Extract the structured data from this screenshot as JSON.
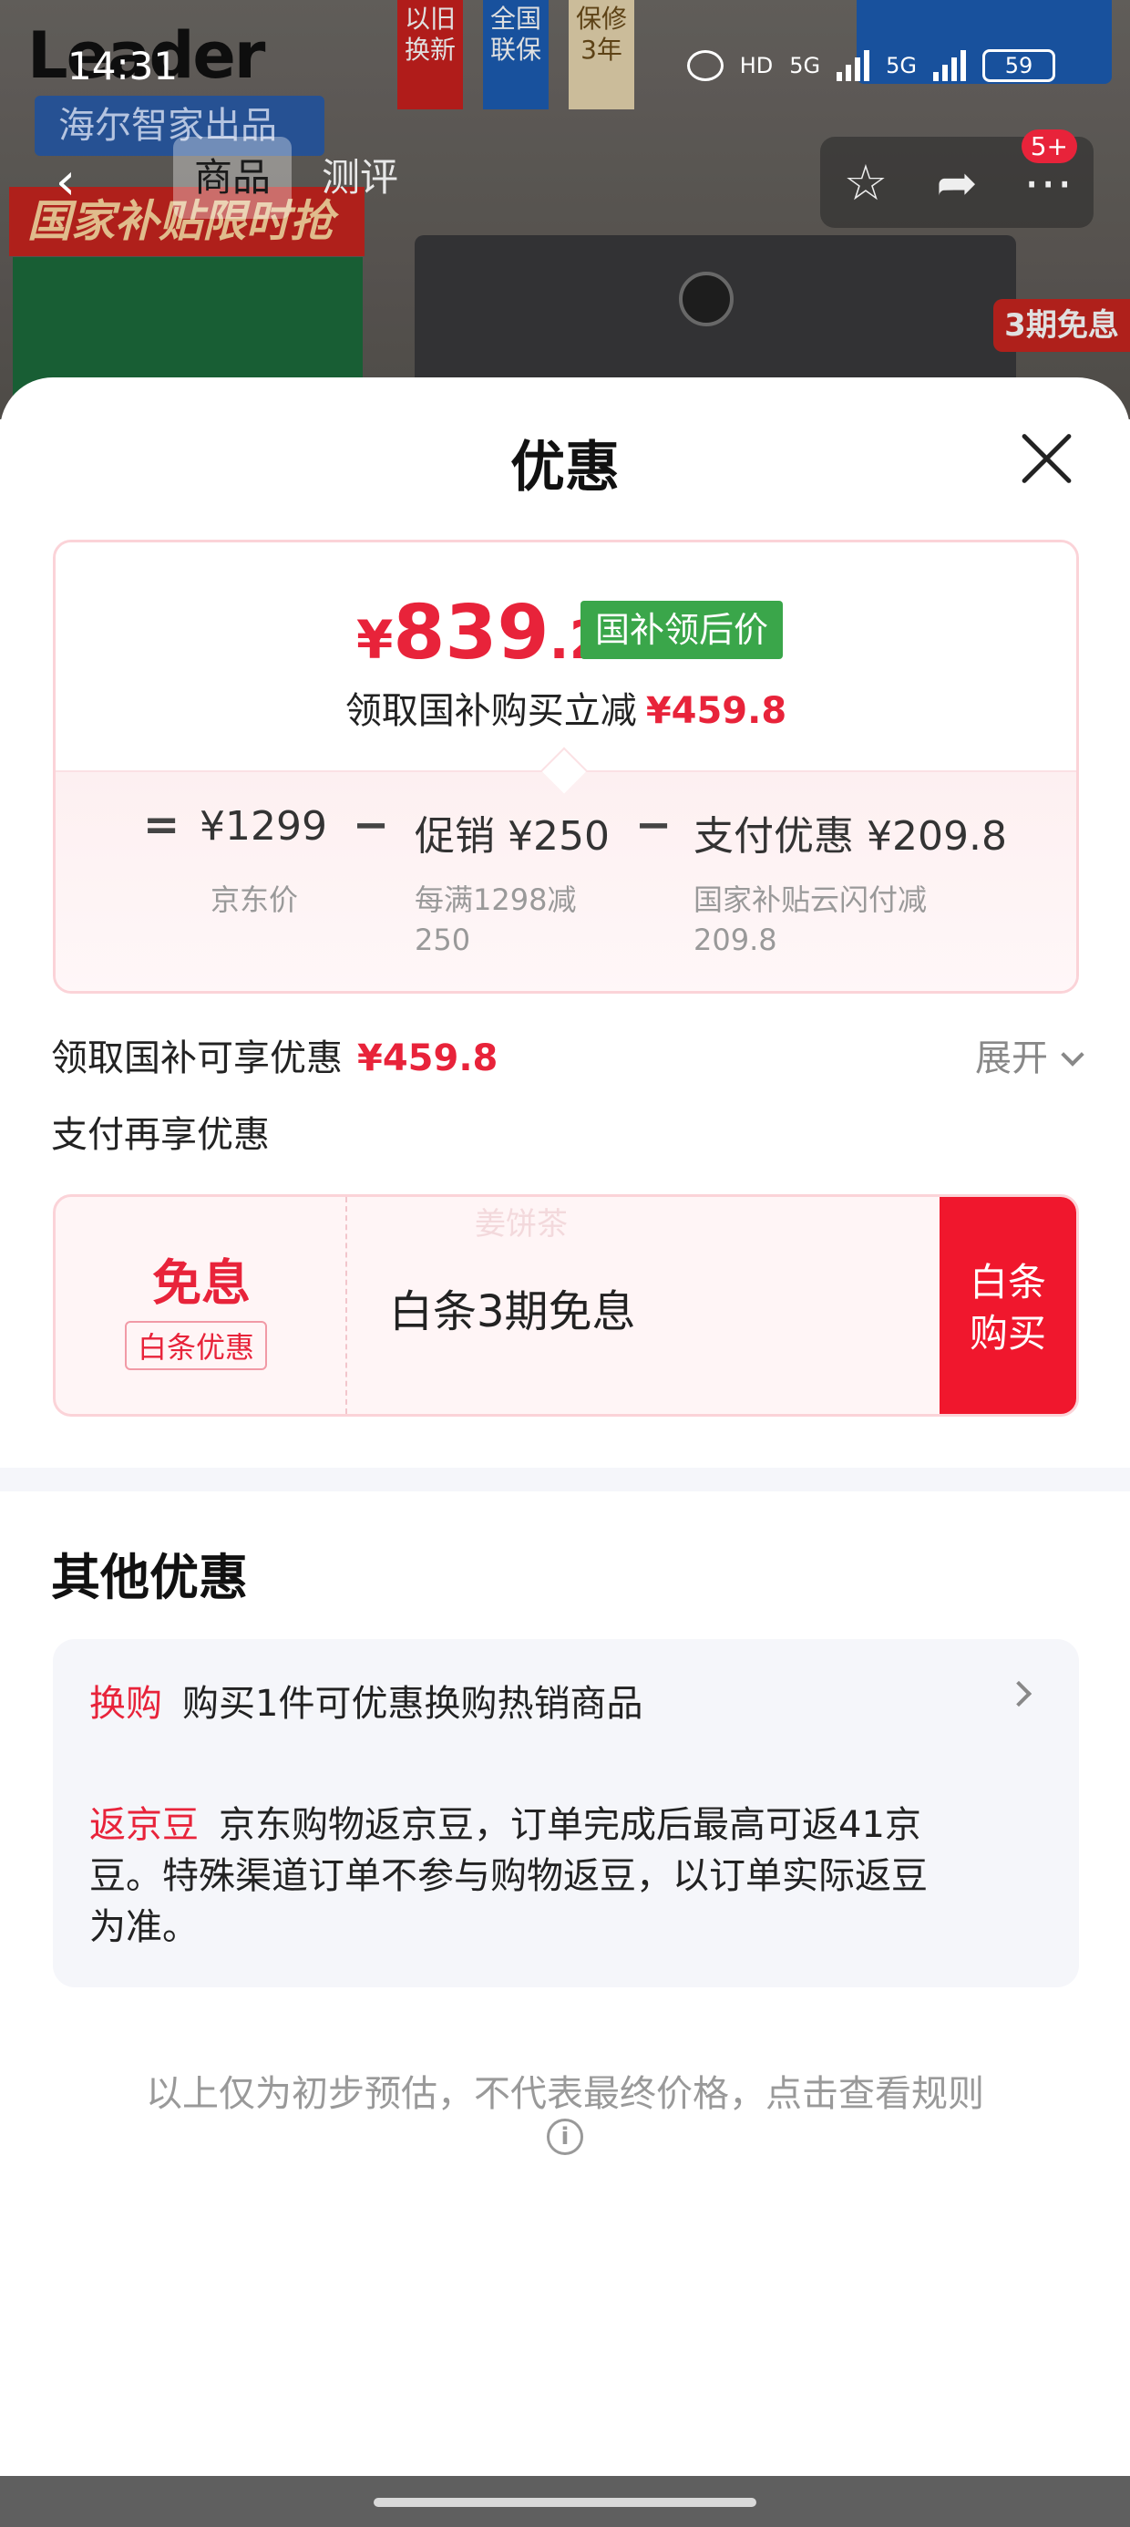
{
  "status_bar": {
    "time": "14:31",
    "network": [
      "5G",
      "5G"
    ],
    "battery": "59",
    "hd_label": "HD"
  },
  "background_page": {
    "brand": "Leader",
    "brand_sub": "海尔智家出品",
    "flags": [
      "以旧换新",
      "全国联保",
      "保修3年"
    ],
    "subsidy_banner": "国家补贴限时抢",
    "interest_badge": "3期免息"
  },
  "nav": {
    "tabs": [
      {
        "label": "商品",
        "active": true
      },
      {
        "label": "测评",
        "active": false
      }
    ],
    "badge": "5+",
    "icons": [
      "back-icon",
      "star-icon",
      "share-icon",
      "more-icon"
    ]
  },
  "sheet": {
    "title": "优惠",
    "price_card": {
      "currency": "¥",
      "price_int": "839",
      "price_dec": ".2",
      "tag": "国补领后价",
      "reduce_text": "领取国补购买立减",
      "reduce_amount": "¥459.8",
      "calc": {
        "eq": "=",
        "base_price": "¥1299",
        "base_label": "京东价",
        "minus1": "−",
        "promo_value": "促销 ¥250",
        "promo_desc": [
          "每满1298减",
          "250"
        ],
        "minus2": "−",
        "pay_value": "支付优惠 ¥209.8",
        "pay_desc": [
          "国家补贴云闪付减",
          "209.8"
        ]
      }
    },
    "subsidy_label": "领取国补可享优惠",
    "subsidy_amount": "¥459.8",
    "expand_label": "展开",
    "pay_more_label": "支付再享优惠",
    "baitiao": {
      "free_label": "免息",
      "tag": "白条优惠",
      "watermark": "姜饼茶",
      "text": "白条3期免息",
      "buy_label": [
        "白条",
        "购买"
      ]
    },
    "other_title": "其他优惠",
    "offers": [
      {
        "tag": "换购",
        "text": "购买1件可优惠换购热销商品"
      },
      {
        "tag": "返京豆",
        "text_lines": [
          "京东购物返京豆，订单完成后最高可返41京",
          "豆。特殊渠道订单不参与购物返豆，以订单实际返豆",
          "为准。"
        ]
      }
    ],
    "disclaimer": "以上仅为初步预估，不代表最终价格，点击查看规则",
    "info_icon_glyph": "i"
  },
  "colors": {
    "accent_red": "#e8233a",
    "button_red": "#f0172d",
    "tag_green": "#3aa64a",
    "card_border": "#fbd3d8"
  }
}
